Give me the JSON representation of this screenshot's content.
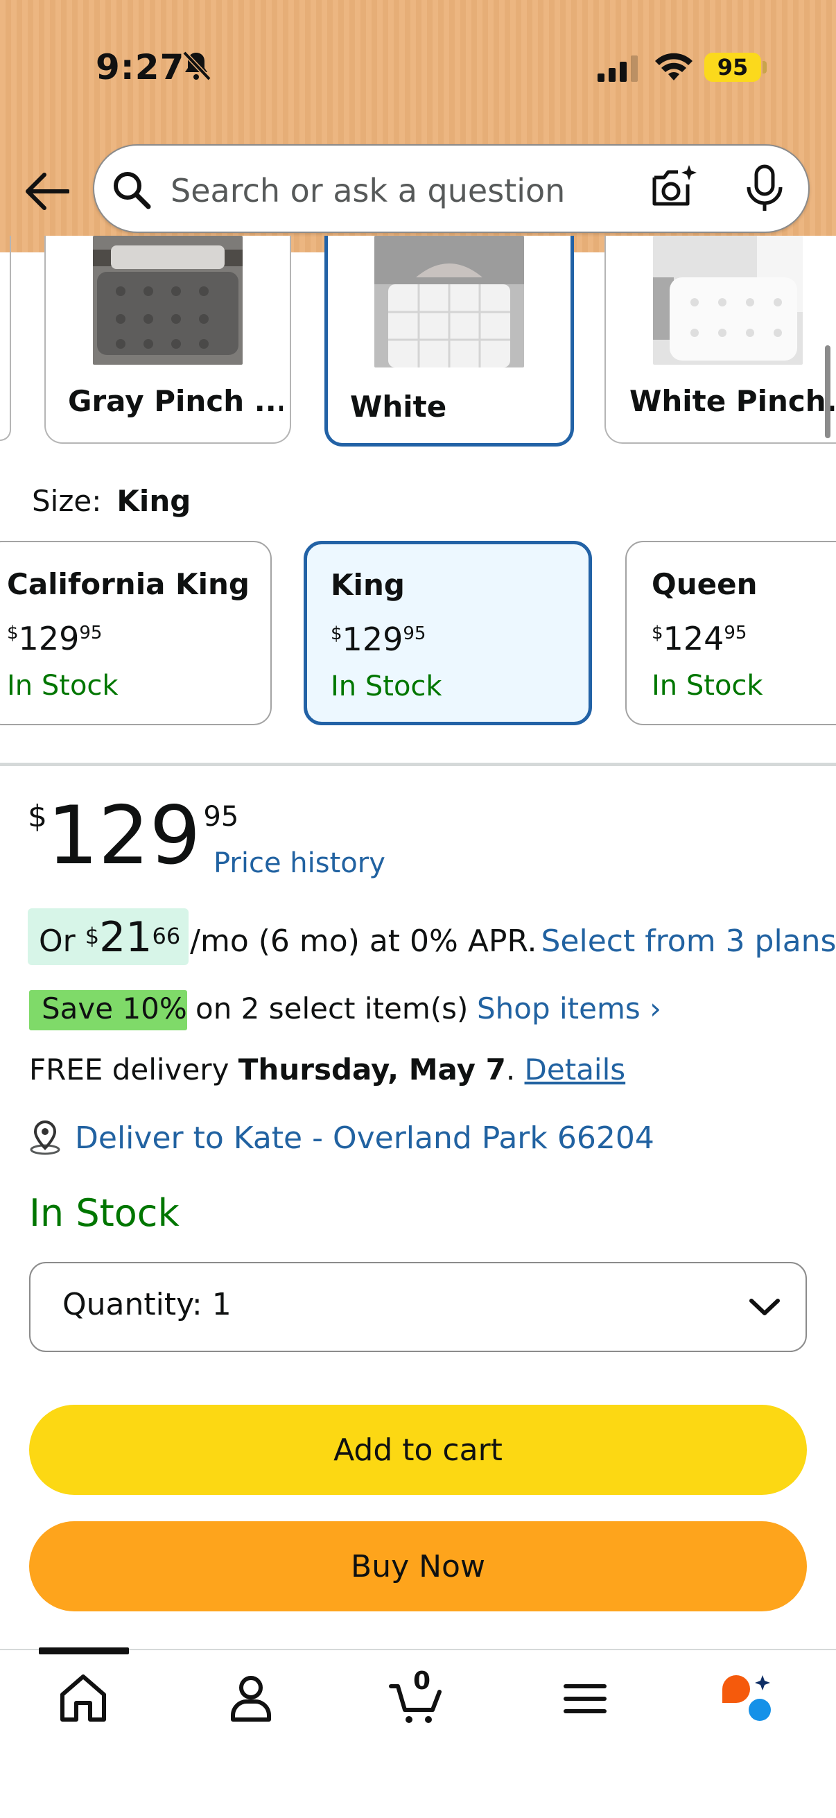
{
  "status_bar": {
    "time": "9:27",
    "battery": "95",
    "icons": [
      "bell-slash-icon",
      "signal-icon",
      "wifi-icon",
      "battery-icon"
    ]
  },
  "header": {
    "search_placeholder": "Search or ask a question",
    "icons": [
      "back-arrow-icon",
      "search-icon",
      "camera-icon",
      "mic-icon"
    ],
    "colors": {
      "background": "#ebb179"
    }
  },
  "color_options": [
    {
      "label": "Gray Pinch ...",
      "selected": false
    },
    {
      "label": "White",
      "selected": true
    },
    {
      "label": "White Pinch...",
      "selected": false
    }
  ],
  "size": {
    "label": "Size:",
    "value": "King",
    "options": [
      {
        "name": "California King",
        "price_currency": "$",
        "price_whole": "129",
        "price_fraction": "95",
        "stock": "In Stock",
        "selected": false
      },
      {
        "name": "King",
        "price_currency": "$",
        "price_whole": "129",
        "price_fraction": "95",
        "stock": "In Stock",
        "selected": true
      },
      {
        "name": "Queen",
        "price_currency": "$",
        "price_whole": "124",
        "price_fraction": "95",
        "stock": "In Stock",
        "selected": false
      }
    ]
  },
  "price": {
    "currency": "$",
    "whole": "129",
    "fraction": "95",
    "history_link": "Price history"
  },
  "installments": {
    "prefix": "Or",
    "currency": "$",
    "whole": "21",
    "fraction": "66",
    "suffix": "/mo (6 mo) at 0% APR.",
    "link": "Select from 3 plans"
  },
  "promo": {
    "badge": "Save 10%",
    "text": "on 2 select item(s)",
    "link": "Shop items ›"
  },
  "delivery": {
    "prefix": "FREE delivery",
    "date": "Thursday, May 7",
    "separator": ".",
    "link": "Details"
  },
  "deliver_to": "Deliver to Kate - Overland Park 66204",
  "availability": "In Stock",
  "quantity": {
    "label": "Quantity:",
    "value": "1"
  },
  "buttons": {
    "add_to_cart": "Add to cart",
    "buy_now": "Buy Now"
  },
  "bottom_nav": {
    "cart_count": "0",
    "items": [
      "home-icon",
      "account-icon",
      "cart-icon",
      "menu-icon",
      "rufus-icon"
    ]
  },
  "colors": {
    "link": "#2162a1",
    "in_stock": "#007600",
    "selected_border": "#2262a6",
    "add_to_cart": "#fcd813",
    "buy_now": "#fea41c",
    "save_badge": "#7fda69"
  }
}
